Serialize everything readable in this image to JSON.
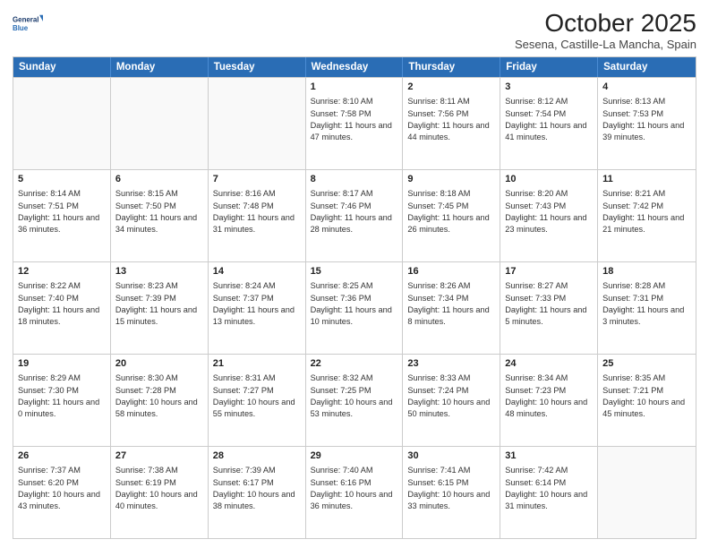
{
  "header": {
    "logo_line1": "General",
    "logo_line2": "Blue",
    "title": "October 2025",
    "subtitle": "Sesena, Castille-La Mancha, Spain"
  },
  "days_of_week": [
    "Sunday",
    "Monday",
    "Tuesday",
    "Wednesday",
    "Thursday",
    "Friday",
    "Saturday"
  ],
  "weeks": [
    [
      {
        "day": "",
        "sunrise": "",
        "sunset": "",
        "daylight": ""
      },
      {
        "day": "",
        "sunrise": "",
        "sunset": "",
        "daylight": ""
      },
      {
        "day": "",
        "sunrise": "",
        "sunset": "",
        "daylight": ""
      },
      {
        "day": "1",
        "sunrise": "Sunrise: 8:10 AM",
        "sunset": "Sunset: 7:58 PM",
        "daylight": "Daylight: 11 hours and 47 minutes."
      },
      {
        "day": "2",
        "sunrise": "Sunrise: 8:11 AM",
        "sunset": "Sunset: 7:56 PM",
        "daylight": "Daylight: 11 hours and 44 minutes."
      },
      {
        "day": "3",
        "sunrise": "Sunrise: 8:12 AM",
        "sunset": "Sunset: 7:54 PM",
        "daylight": "Daylight: 11 hours and 41 minutes."
      },
      {
        "day": "4",
        "sunrise": "Sunrise: 8:13 AM",
        "sunset": "Sunset: 7:53 PM",
        "daylight": "Daylight: 11 hours and 39 minutes."
      }
    ],
    [
      {
        "day": "5",
        "sunrise": "Sunrise: 8:14 AM",
        "sunset": "Sunset: 7:51 PM",
        "daylight": "Daylight: 11 hours and 36 minutes."
      },
      {
        "day": "6",
        "sunrise": "Sunrise: 8:15 AM",
        "sunset": "Sunset: 7:50 PM",
        "daylight": "Daylight: 11 hours and 34 minutes."
      },
      {
        "day": "7",
        "sunrise": "Sunrise: 8:16 AM",
        "sunset": "Sunset: 7:48 PM",
        "daylight": "Daylight: 11 hours and 31 minutes."
      },
      {
        "day": "8",
        "sunrise": "Sunrise: 8:17 AM",
        "sunset": "Sunset: 7:46 PM",
        "daylight": "Daylight: 11 hours and 28 minutes."
      },
      {
        "day": "9",
        "sunrise": "Sunrise: 8:18 AM",
        "sunset": "Sunset: 7:45 PM",
        "daylight": "Daylight: 11 hours and 26 minutes."
      },
      {
        "day": "10",
        "sunrise": "Sunrise: 8:20 AM",
        "sunset": "Sunset: 7:43 PM",
        "daylight": "Daylight: 11 hours and 23 minutes."
      },
      {
        "day": "11",
        "sunrise": "Sunrise: 8:21 AM",
        "sunset": "Sunset: 7:42 PM",
        "daylight": "Daylight: 11 hours and 21 minutes."
      }
    ],
    [
      {
        "day": "12",
        "sunrise": "Sunrise: 8:22 AM",
        "sunset": "Sunset: 7:40 PM",
        "daylight": "Daylight: 11 hours and 18 minutes."
      },
      {
        "day": "13",
        "sunrise": "Sunrise: 8:23 AM",
        "sunset": "Sunset: 7:39 PM",
        "daylight": "Daylight: 11 hours and 15 minutes."
      },
      {
        "day": "14",
        "sunrise": "Sunrise: 8:24 AM",
        "sunset": "Sunset: 7:37 PM",
        "daylight": "Daylight: 11 hours and 13 minutes."
      },
      {
        "day": "15",
        "sunrise": "Sunrise: 8:25 AM",
        "sunset": "Sunset: 7:36 PM",
        "daylight": "Daylight: 11 hours and 10 minutes."
      },
      {
        "day": "16",
        "sunrise": "Sunrise: 8:26 AM",
        "sunset": "Sunset: 7:34 PM",
        "daylight": "Daylight: 11 hours and 8 minutes."
      },
      {
        "day": "17",
        "sunrise": "Sunrise: 8:27 AM",
        "sunset": "Sunset: 7:33 PM",
        "daylight": "Daylight: 11 hours and 5 minutes."
      },
      {
        "day": "18",
        "sunrise": "Sunrise: 8:28 AM",
        "sunset": "Sunset: 7:31 PM",
        "daylight": "Daylight: 11 hours and 3 minutes."
      }
    ],
    [
      {
        "day": "19",
        "sunrise": "Sunrise: 8:29 AM",
        "sunset": "Sunset: 7:30 PM",
        "daylight": "Daylight: 11 hours and 0 minutes."
      },
      {
        "day": "20",
        "sunrise": "Sunrise: 8:30 AM",
        "sunset": "Sunset: 7:28 PM",
        "daylight": "Daylight: 10 hours and 58 minutes."
      },
      {
        "day": "21",
        "sunrise": "Sunrise: 8:31 AM",
        "sunset": "Sunset: 7:27 PM",
        "daylight": "Daylight: 10 hours and 55 minutes."
      },
      {
        "day": "22",
        "sunrise": "Sunrise: 8:32 AM",
        "sunset": "Sunset: 7:25 PM",
        "daylight": "Daylight: 10 hours and 53 minutes."
      },
      {
        "day": "23",
        "sunrise": "Sunrise: 8:33 AM",
        "sunset": "Sunset: 7:24 PM",
        "daylight": "Daylight: 10 hours and 50 minutes."
      },
      {
        "day": "24",
        "sunrise": "Sunrise: 8:34 AM",
        "sunset": "Sunset: 7:23 PM",
        "daylight": "Daylight: 10 hours and 48 minutes."
      },
      {
        "day": "25",
        "sunrise": "Sunrise: 8:35 AM",
        "sunset": "Sunset: 7:21 PM",
        "daylight": "Daylight: 10 hours and 45 minutes."
      }
    ],
    [
      {
        "day": "26",
        "sunrise": "Sunrise: 7:37 AM",
        "sunset": "Sunset: 6:20 PM",
        "daylight": "Daylight: 10 hours and 43 minutes."
      },
      {
        "day": "27",
        "sunrise": "Sunrise: 7:38 AM",
        "sunset": "Sunset: 6:19 PM",
        "daylight": "Daylight: 10 hours and 40 minutes."
      },
      {
        "day": "28",
        "sunrise": "Sunrise: 7:39 AM",
        "sunset": "Sunset: 6:17 PM",
        "daylight": "Daylight: 10 hours and 38 minutes."
      },
      {
        "day": "29",
        "sunrise": "Sunrise: 7:40 AM",
        "sunset": "Sunset: 6:16 PM",
        "daylight": "Daylight: 10 hours and 36 minutes."
      },
      {
        "day": "30",
        "sunrise": "Sunrise: 7:41 AM",
        "sunset": "Sunset: 6:15 PM",
        "daylight": "Daylight: 10 hours and 33 minutes."
      },
      {
        "day": "31",
        "sunrise": "Sunrise: 7:42 AM",
        "sunset": "Sunset: 6:14 PM",
        "daylight": "Daylight: 10 hours and 31 minutes."
      },
      {
        "day": "",
        "sunrise": "",
        "sunset": "",
        "daylight": ""
      }
    ]
  ]
}
